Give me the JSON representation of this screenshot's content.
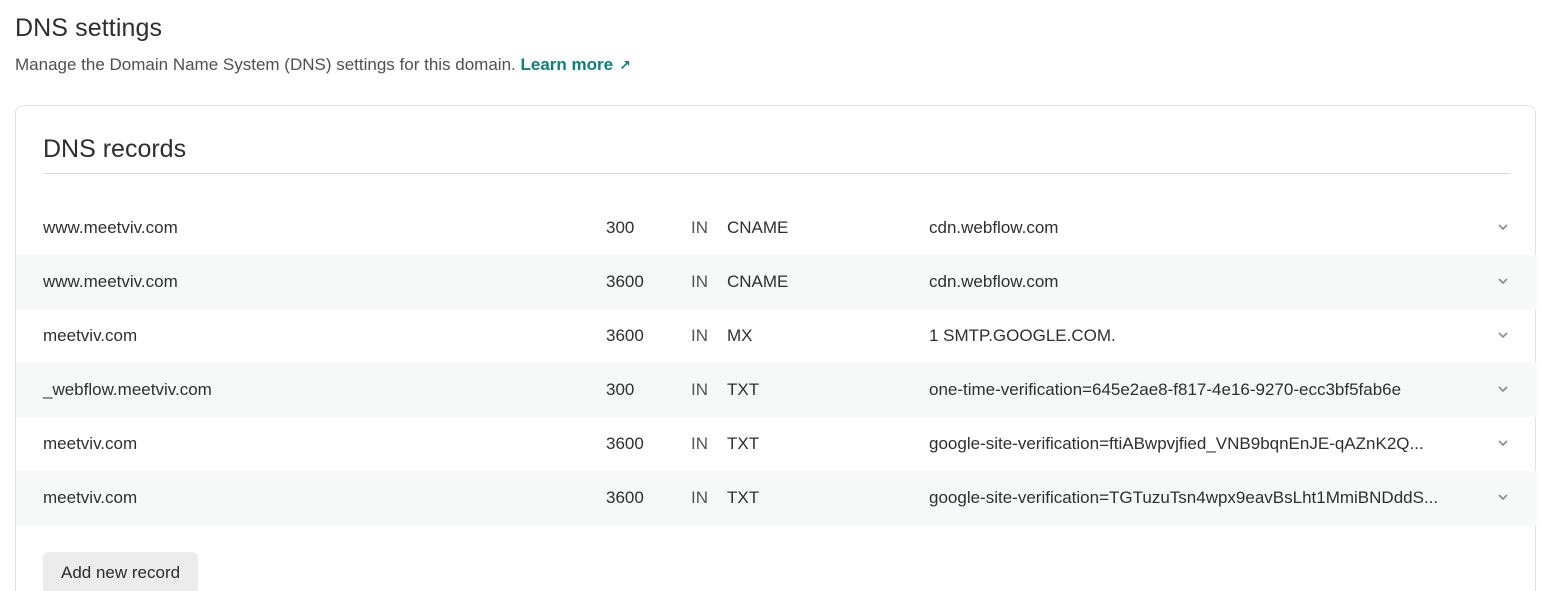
{
  "header": {
    "title": "DNS settings",
    "subtitle": "Manage the Domain Name System (DNS) settings for this domain.",
    "learn_more": "Learn more",
    "learn_more_icon": "external-link-icon"
  },
  "card": {
    "title": "DNS records",
    "add_button": "Add new record",
    "records": [
      {
        "name": "www.meetviv.com",
        "ttl": "300",
        "class": "IN",
        "type": "CNAME",
        "value": "cdn.webflow.com"
      },
      {
        "name": "www.meetviv.com",
        "ttl": "3600",
        "class": "IN",
        "type": "CNAME",
        "value": "cdn.webflow.com"
      },
      {
        "name": "meetviv.com",
        "ttl": "3600",
        "class": "IN",
        "type": "MX",
        "value": "1 SMTP.GOOGLE.COM."
      },
      {
        "name": "_webflow.meetviv.com",
        "ttl": "300",
        "class": "IN",
        "type": "TXT",
        "value": "one-time-verification=645e2ae8-f817-4e16-9270-ecc3bf5fab6e"
      },
      {
        "name": "meetviv.com",
        "ttl": "3600",
        "class": "IN",
        "type": "TXT",
        "value": "google-site-verification=ftiABwpvjfied_VNB9bqnEnJE-qAZnK2Q..."
      },
      {
        "name": "meetviv.com",
        "ttl": "3600",
        "class": "IN",
        "type": "TXT",
        "value": "google-site-verification=TGTuzuTsn4wpx9eavBsLht1MmiBNDddS..."
      }
    ]
  },
  "colors": {
    "accent": "#0e7f7a",
    "row_alt": "#f7f8f8",
    "button_bg": "#ececec"
  }
}
